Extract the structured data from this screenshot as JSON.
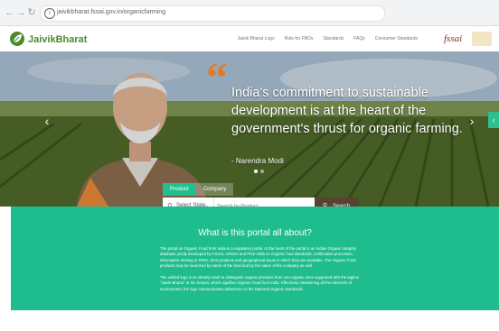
{
  "browser": {
    "url": "jaivikbharat.fssai.gov.in/organicfarming",
    "back_icon": "back-arrow-icon",
    "reload_icon": "reload-icon"
  },
  "header": {
    "logo_text": "JaivikBharat",
    "nav_links": [
      "Jaivik Bharat Logo",
      "Role for FBOs",
      "Standards",
      "FAQs",
      "Consumer Standards"
    ],
    "partner_logo_text": "fssai"
  },
  "hero": {
    "quote": "India's commitment to sustainable development is at the heart of the government's thrust for organic farming.",
    "author": "- Narendra Modi",
    "slides": 2,
    "active_slide": 1
  },
  "search": {
    "tabs": [
      "Product",
      "Company"
    ],
    "active_tab": "Product",
    "state_label": "Select State",
    "product_placeholder": "Search by Product",
    "button_label": "Search"
  },
  "about": {
    "title": "What is this portal all about?",
    "paragraph1": "The portal on Organic Food from India is a regulatory portal. At the heart of the portal is an Indian Organic integrity database jointly developed by FSSAI, APEDA and PGS India on Organic food standards, certification processes, information relating to FBOs, their products and geographical areas in which they are available. The Organic Food products may be searched by name of the food and by the name of the company as well.",
    "paragraph2": "The unified logo is an identity mark to distinguish organic products from non-organic ones supported with the tagline \"Jaivik Bharat\" at the bottom, which signifies Organic Food from India. Effectively intertwining all the elements of environment, the logo communicates adherence to the National Organic Standards."
  },
  "colors": {
    "teal": "#1fbc8d",
    "search_button": "#5a4232",
    "quote_mark": "#e07b2b",
    "logo_green": "#4a8b2c"
  }
}
